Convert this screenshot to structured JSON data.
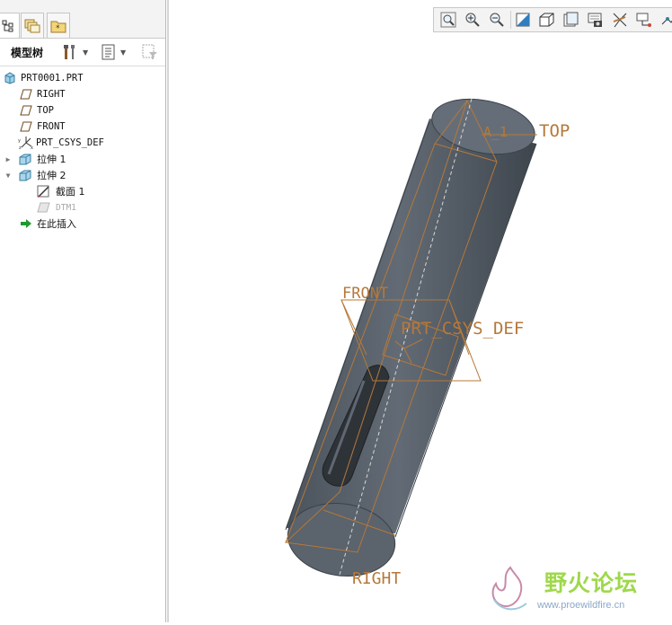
{
  "panel": {
    "title": "模型树",
    "tabs": [
      "model-tree-tab",
      "layers-tab",
      "favorites-tab"
    ]
  },
  "tree": {
    "root": "PRT0001.PRT",
    "items": [
      {
        "label": "RIGHT",
        "icon": "datum-plane-icon"
      },
      {
        "label": "TOP",
        "icon": "datum-plane-icon"
      },
      {
        "label": "FRONT",
        "icon": "datum-plane-icon"
      },
      {
        "label": "PRT_CSYS_DEF",
        "icon": "csys-icon"
      },
      {
        "label": "拉伸 1",
        "icon": "extrude-icon",
        "expander": "collapsed"
      },
      {
        "label": "拉伸 2",
        "icon": "extrude-icon",
        "expander": "expanded"
      },
      {
        "label": "截面 1",
        "icon": "sketch-icon",
        "child": true
      },
      {
        "label": "DTM1",
        "icon": "datum-plane-icon",
        "child": true,
        "dim": true
      },
      {
        "label": "在此插入",
        "icon": "insert-arrow-icon"
      }
    ]
  },
  "toolbar": {
    "icons": [
      "zoom-fit-icon",
      "zoom-in-icon",
      "zoom-out-icon",
      "repaint-icon",
      "display-style-icon",
      "saved-views-icon",
      "view-manager-icon",
      "datum-display-icon",
      "spin-center-icon",
      "annotation-icon"
    ]
  },
  "viewport": {
    "labels": {
      "top": "TOP",
      "front": "FRONT",
      "csys": "PRT_CSYS_DEF",
      "right": "RIGHT",
      "axis": "A_1"
    },
    "colors": {
      "datum": "#b5783a",
      "body": "#5d6670",
      "background": "#ffffff"
    }
  },
  "watermark": {
    "text": "野火论坛",
    "url": "www.proewildfire.cn"
  }
}
